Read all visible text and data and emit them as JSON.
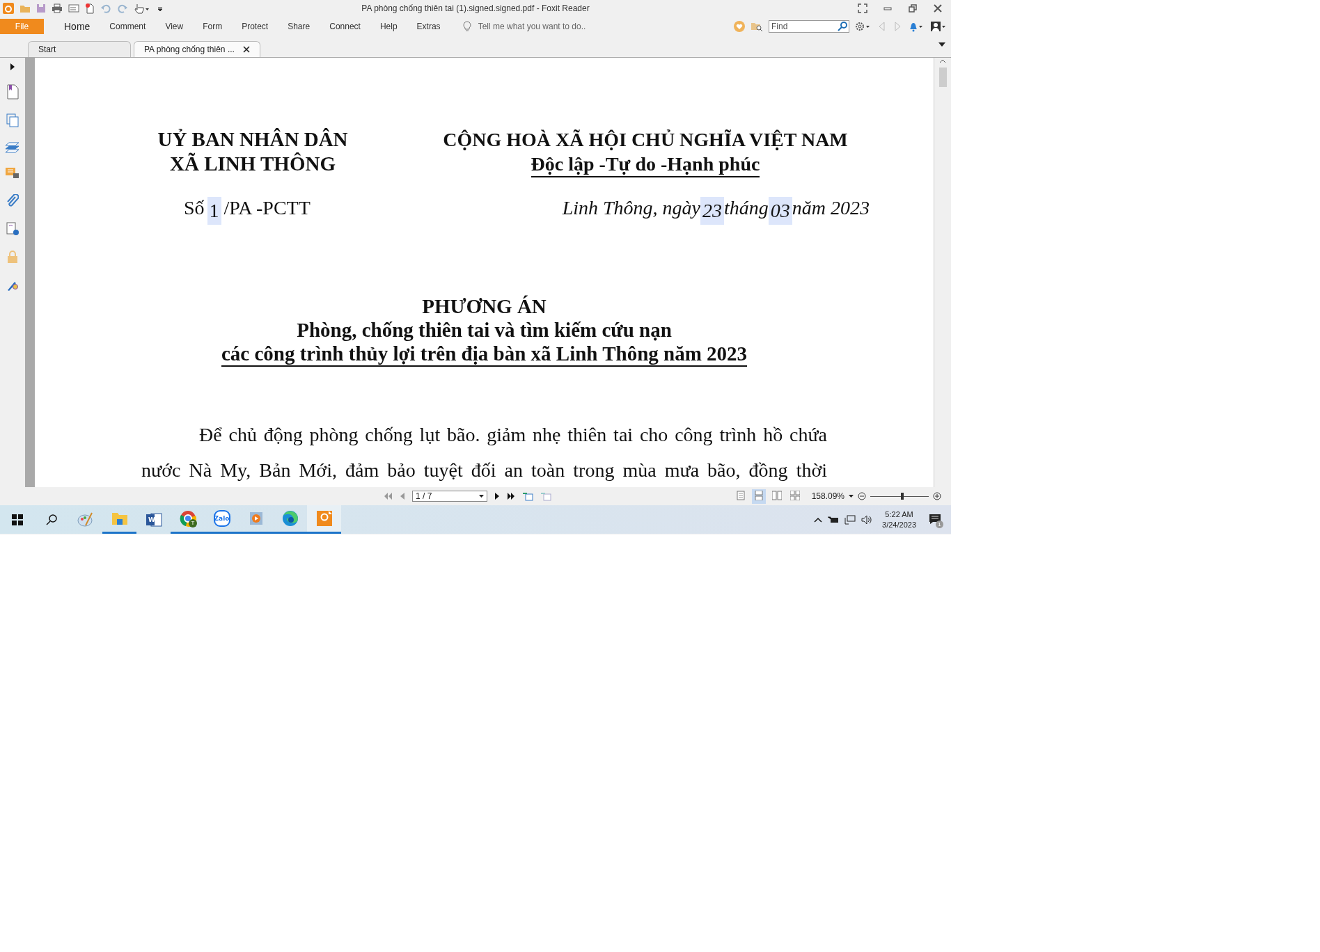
{
  "window": {
    "title": "PA phòng chống thiên tai (1).signed.signed.pdf - Foxit Reader"
  },
  "menu": [
    {
      "label": "File",
      "kind": "file",
      "selected": false
    },
    {
      "label": "Home",
      "kind": "tab",
      "selected": true
    },
    {
      "label": "Comment",
      "kind": "tab",
      "selected": false
    },
    {
      "label": "View",
      "kind": "tab",
      "selected": false
    },
    {
      "label": "Form",
      "kind": "tab",
      "selected": false
    },
    {
      "label": "Protect",
      "kind": "tab",
      "selected": false
    },
    {
      "label": "Share",
      "kind": "tab",
      "selected": false
    },
    {
      "label": "Connect",
      "kind": "tab",
      "selected": false
    },
    {
      "label": "Help",
      "kind": "tab",
      "selected": false
    },
    {
      "label": "Extras",
      "kind": "tab",
      "selected": false
    }
  ],
  "tell_me": {
    "placeholder": "Tell me what you want to do.."
  },
  "find": {
    "placeholder": "Find"
  },
  "tabs": [
    {
      "label": "Start",
      "selected": false,
      "closable": false
    },
    {
      "label": "PA phòng chống thiên ...",
      "selected": true,
      "closable": true
    }
  ],
  "document": {
    "header_left": [
      "UỶ BAN NHÂN DÂN",
      "XÃ LINH THÔNG"
    ],
    "header_right": [
      "CỘNG HOÀ XÃ HỘI CHỦ NGHĨA VIỆT NAM",
      "Độc lập -Tự do -Hạnh phúc"
    ],
    "number_line": [
      {
        "text": "Số",
        "field": false
      },
      {
        "text": "1",
        "field": true
      },
      {
        "text": "/PA -PCTT",
        "field": false
      }
    ],
    "date_line": [
      {
        "text": "Linh Thông, ngày",
        "field": false
      },
      {
        "text": "23",
        "field": true
      },
      {
        "text": "tháng",
        "field": false
      },
      {
        "text": "03",
        "field": true
      },
      {
        "text": "năm 2023",
        "field": false
      }
    ],
    "title": [
      "PHƯƠNG ÁN",
      "Phòng, chống thiên tai và tìm kiếm cứu nạn",
      "các công trình thủy lợi trên địa bàn xã Linh Thông năm 2023"
    ],
    "paragraph_lines": [
      "Để chủ động phòng chống lụt bão. giảm nhẹ thiên tai cho công trình hồ chứa",
      "nước Nà My, Bản Mới, đảm bảo tuyệt đối an toàn trong mùa mưa bão, đồng thời"
    ]
  },
  "status_bar": {
    "page": "1 / 7",
    "view_modes": [
      {
        "selected": false
      },
      {
        "selected": true
      },
      {
        "selected": false
      },
      {
        "selected": false
      }
    ],
    "zoom": "158.09%",
    "zoom_slider": {
      "level": 0.55
    }
  },
  "taskbar": {
    "apps": [
      {
        "kind": "paint",
        "running": false
      },
      {
        "kind": "explorer",
        "running": true
      },
      {
        "kind": "word",
        "label": "W",
        "running": false
      },
      {
        "kind": "chrome",
        "badge": "T",
        "running": true
      },
      {
        "kind": "zalo",
        "label": "Zalo",
        "running": true
      },
      {
        "kind": "media",
        "running": true
      },
      {
        "kind": "edge",
        "running": true
      },
      {
        "kind": "foxit",
        "running": true
      }
    ],
    "time": "5:22 AM",
    "date": "3/24/2023",
    "notifications": "1"
  }
}
